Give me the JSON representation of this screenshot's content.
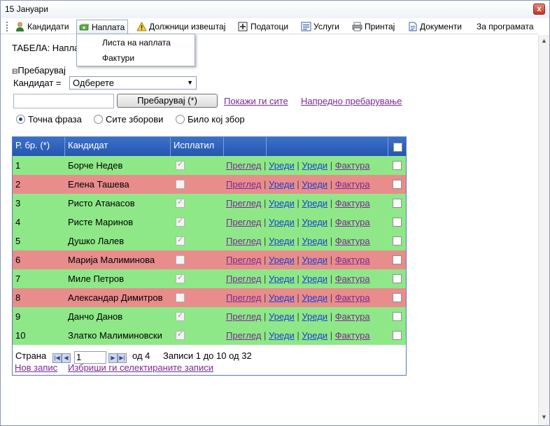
{
  "window": {
    "title": "15 Јануари",
    "close_label": "x"
  },
  "menu": [
    {
      "label": "Кандидати",
      "icon": "person-icon"
    },
    {
      "label": "Наплата",
      "icon": "money-icon"
    },
    {
      "label": "Должници извештај",
      "icon": "warning-icon"
    },
    {
      "label": "Податоци",
      "icon": "plus-box-icon"
    },
    {
      "label": "Услуги",
      "icon": "list-icon"
    },
    {
      "label": "Принтај",
      "icon": "printer-icon"
    },
    {
      "label": "Документи",
      "icon": "document-icon"
    },
    {
      "label": "За програмата",
      "icon": ""
    }
  ],
  "dropdown": [
    {
      "label": "Листа на наплата"
    },
    {
      "label": "Фактури"
    }
  ],
  "page": {
    "heading": "ТАБЕЛА: Напла"
  },
  "search": {
    "section_label": "Пребарувај",
    "toggle_glyph": "⊟",
    "field_label": "Кандидат =",
    "select_value": "Одберете",
    "text_value": "",
    "button_label": "Пребарувај (*)",
    "show_all_link": "Покажи ги сите",
    "advanced_link": "Напредно пребарување",
    "modes": [
      {
        "label": "Точна фраза",
        "selected": true
      },
      {
        "label": "Сите зборови",
        "selected": false
      },
      {
        "label": "Било кој збор",
        "selected": false
      }
    ]
  },
  "grid": {
    "columns": [
      "Р. бр. (*)",
      "Кандидат",
      "Исплатил",
      "",
      "",
      ""
    ],
    "actions": {
      "view": "Преглед",
      "edit": "Уреди",
      "edit2": "Уреди",
      "invoice": "Фактура"
    },
    "rows": [
      {
        "no": "1",
        "name": "Борче Недев",
        "paid": true
      },
      {
        "no": "2",
        "name": "Елена Ташева",
        "paid": false
      },
      {
        "no": "3",
        "name": "Ристо Атанасов",
        "paid": true
      },
      {
        "no": "4",
        "name": "Ристе Маринов",
        "paid": true
      },
      {
        "no": "5",
        "name": "Душко Лалев",
        "paid": true
      },
      {
        "no": "6",
        "name": "Марија Малиминова",
        "paid": false
      },
      {
        "no": "7",
        "name": "Миле Петров",
        "paid": true
      },
      {
        "no": "8",
        "name": "Александар Димитров",
        "paid": false
      },
      {
        "no": "9",
        "name": "Данчо Данов",
        "paid": true
      },
      {
        "no": "10",
        "name": "Златко Малиминовски",
        "paid": true
      }
    ],
    "colors": {
      "paid_row": "#8ee887",
      "unpaid_row": "#e98c8c",
      "header": "#2f63bf"
    },
    "pager": {
      "page_label": "Страна",
      "page_value": "1",
      "of_label": "од 4",
      "records_label": "Записи 1 до 10 од 32"
    },
    "new_record_link": "Нов запис",
    "delete_selected_link": "Избриши ги селектираните записи"
  }
}
